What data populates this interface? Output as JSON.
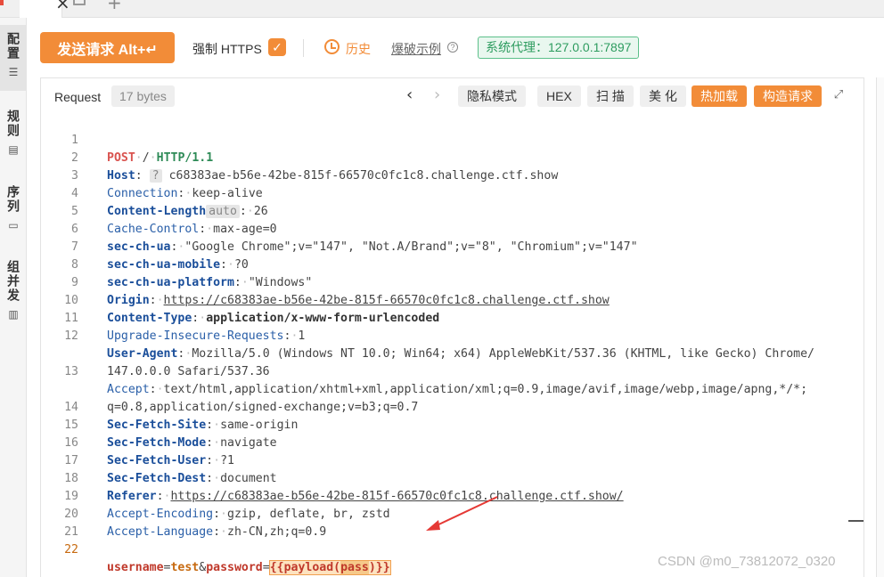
{
  "toolbar": {
    "send_label": "发送请求 Alt+↵",
    "https_label": "强制 HTTPS",
    "https_checked": true,
    "history_label": "历史",
    "example_label": "爆破示例",
    "proxy_label": "系统代理：127.0.0.1:7897"
  },
  "sidebar": {
    "items": [
      {
        "label": "配置",
        "icon": "sliders-icon",
        "active": true
      },
      {
        "label": "规则",
        "icon": "clipboard-icon",
        "active": false
      },
      {
        "label": "序列",
        "icon": "stack-icon",
        "active": false
      },
      {
        "label": "组并发",
        "icon": "columns-icon",
        "active": false
      }
    ]
  },
  "request": {
    "title": "Request",
    "size": "17 bytes",
    "buttons": {
      "privacy": "隐私模式",
      "hex": "HEX",
      "scan": "扫 描",
      "beautify": "美 化",
      "hot_load": "热加载",
      "build_request": "构造请求"
    },
    "line_numbers": [
      "1",
      "2",
      "3",
      "4",
      "5",
      "6",
      "7",
      "8",
      "9",
      "10",
      "11",
      "12",
      "",
      "13",
      "",
      "14",
      "15",
      "16",
      "17",
      "18",
      "19",
      "20",
      "21",
      "22"
    ],
    "lines": {
      "l1_method": "POST",
      "l1_path": "/",
      "l1_proto": "HTTP/1.1",
      "l2_key": "Host",
      "l2_hint": "?",
      "l2_val": "c68383ae-b56e-42be-815f-66570c0fc1c8.challenge.ctf.show",
      "l3_key": "Connection",
      "l3_val": "keep-alive",
      "l4_key": "Content-Length",
      "l4_hint": "auto",
      "l4_val": "26",
      "l5_key": "Cache-Control",
      "l5_val": "max-age=0",
      "l6_key": "sec-ch-ua",
      "l6_val": "\"Google Chrome\";v=\"147\", \"Not.A/Brand\";v=\"8\", \"Chromium\";v=\"147\"",
      "l7_key": "sec-ch-ua-mobile",
      "l7_val": "?0",
      "l8_key": "sec-ch-ua-platform",
      "l8_val": "\"Windows\"",
      "l9_key": "Origin",
      "l9_val": "https://c68383ae-b56e-42be-815f-66570c0fc1c8.challenge.ctf.show",
      "l10_key": "Content-Type",
      "l10_val": "application/x-www-form-urlencoded",
      "l11_key": "Upgrade-Insecure-Requests",
      "l11_val": "1",
      "l12_key": "User-Agent",
      "l12_val": "Mozilla/5.0 (Windows NT 10.0; Win64; x64) AppleWebKit/537.36 (KHTML, like Gecko) Chrome/",
      "l12_cont": "147.0.0.0 Safari/537.36",
      "l13_key": "Accept",
      "l13_val": "text/html,application/xhtml+xml,application/xml;q=0.9,image/avif,image/webp,image/apng,*/*;",
      "l13_cont": "q=0.8,application/signed-exchange;v=b3;q=0.7",
      "l14_key": "Sec-Fetch-Site",
      "l14_val": "same-origin",
      "l15_key": "Sec-Fetch-Mode",
      "l15_val": "navigate",
      "l16_key": "Sec-Fetch-User",
      "l16_val": "?1",
      "l17_key": "Sec-Fetch-Dest",
      "l17_val": "document",
      "l18_key": "Referer",
      "l18_val": "https://c68383ae-b56e-42be-815f-66570c0fc1c8.challenge.ctf.show/",
      "l19_key": "Accept-Encoding",
      "l19_val": "gzip, deflate, br, zstd",
      "l20_key": "Accept-Language",
      "l20_val": "zh-CN,zh;q=0.9",
      "body_k1": "username",
      "body_v1": "test",
      "body_amp": "&",
      "body_k2": "password",
      "body_eq": "=",
      "payload_open": "{{payload(",
      "payload_arg": "pass",
      "payload_close": ")}}"
    }
  },
  "watermark": "CSDN @m0_73812072_0320",
  "colors": {
    "accent": "#f28c38",
    "proxy_green": "#2d9c5f",
    "annotation_arrow": "#e53935"
  }
}
